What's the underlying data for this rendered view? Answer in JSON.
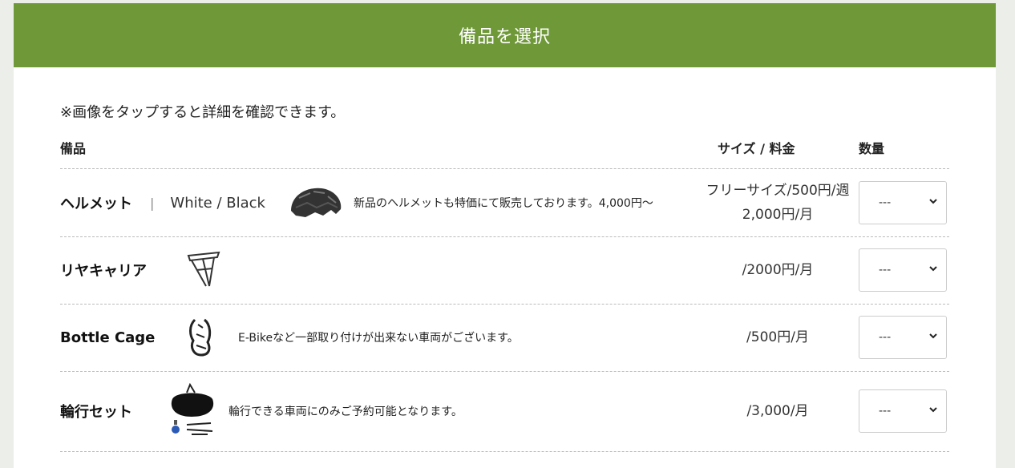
{
  "header": {
    "title": "備品を選択"
  },
  "note": "※画像をタップすると詳細を確認できます。",
  "table": {
    "col_item": "備品",
    "col_size": "サイズ / 料金",
    "col_qty": "数量"
  },
  "rows": [
    {
      "name": "ヘルメット",
      "separator": "|",
      "variant": "White / Black",
      "image": "helmet-image",
      "description": "新品のヘルメットも特価にて販売しております。4,000円～",
      "price_line1": "フリーサイズ/500円/週",
      "price_line2": "2,000円/月",
      "qty": "---"
    },
    {
      "name": "リヤキャリア",
      "image": "rear-carrier-image",
      "description": "",
      "price_line1": "/2000円/月",
      "price_line2": "",
      "qty": "---"
    },
    {
      "name": "Bottle Cage",
      "image": "bottle-cage-image",
      "description": "E-Bikeなど一部取り付けが出来ない車両がございます。",
      "price_line1": "/500円/月",
      "price_line2": "",
      "qty": "---"
    },
    {
      "name": "輪行セット",
      "image": "bike-bag-set-image",
      "description": "輪行できる車両にのみご予約可能となります。",
      "price_line1": "/3,000/月",
      "price_line2": "",
      "qty": "---"
    }
  ],
  "colors": {
    "header_bg": "#6f9838",
    "page_bg": "#eceee9"
  }
}
